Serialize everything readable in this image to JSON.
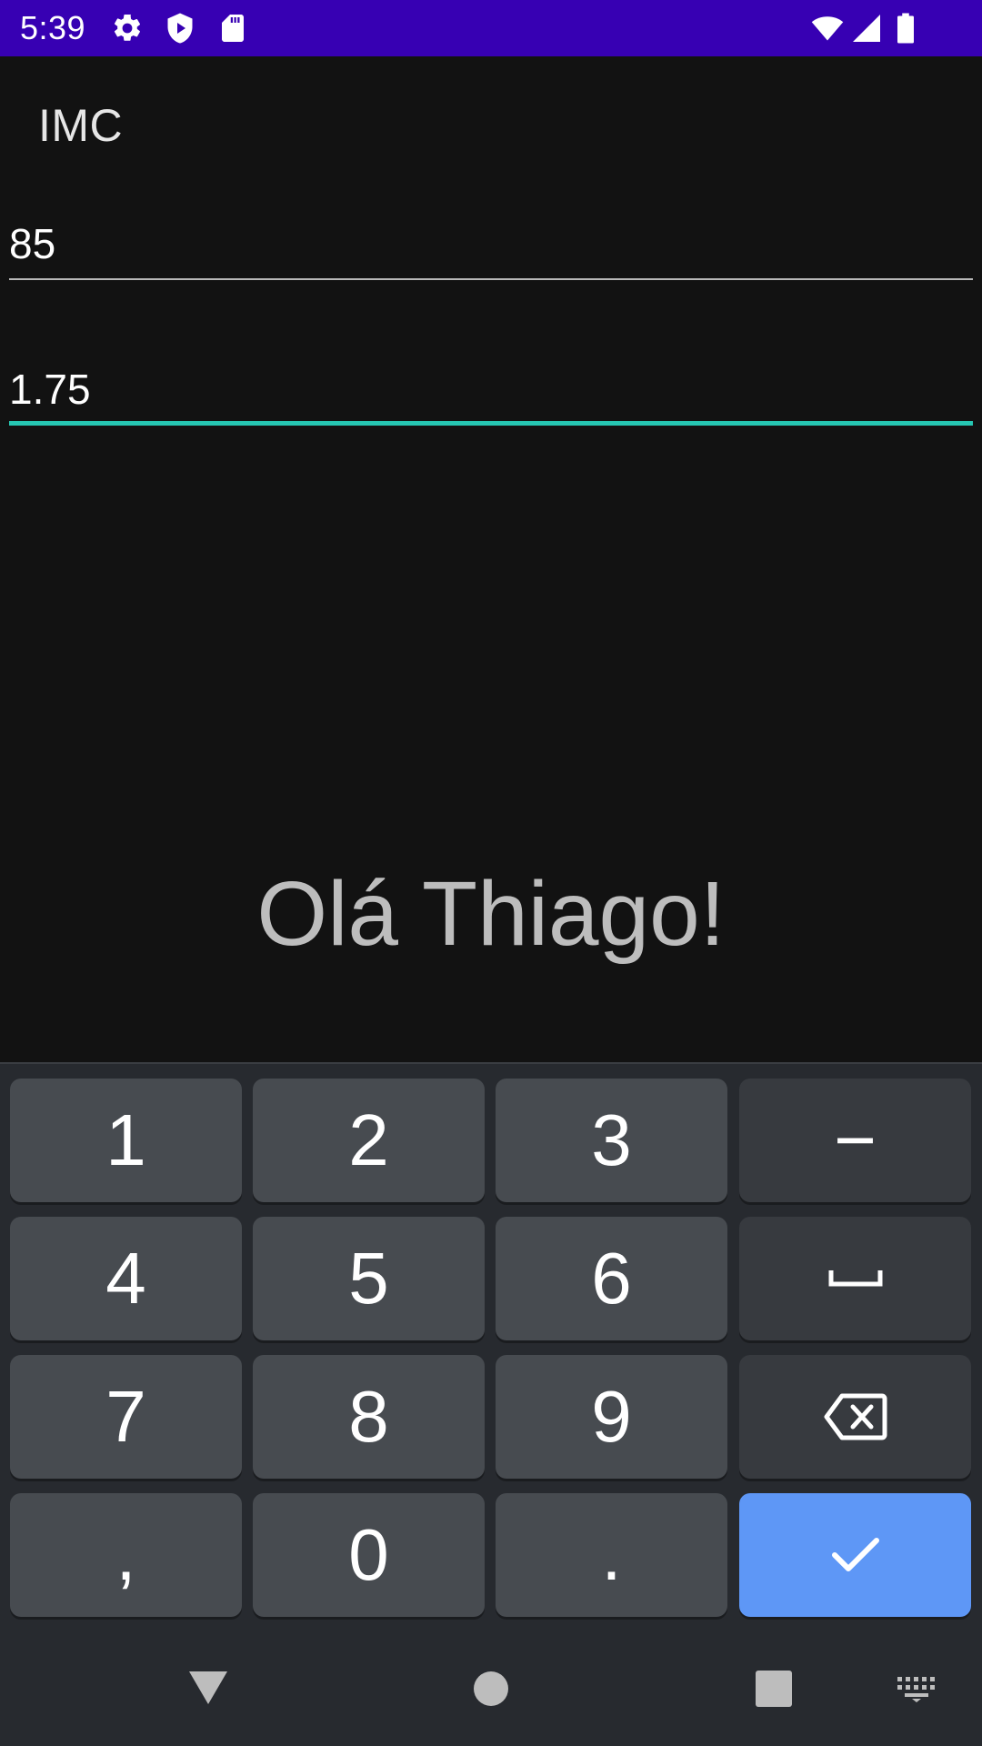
{
  "status_bar": {
    "time": "5:39",
    "background": "#3700b3",
    "icons_left": [
      "settings-icon",
      "play-protect-icon",
      "sd-card-icon"
    ],
    "icons_right": [
      "wifi-icon",
      "signal-icon",
      "battery-icon"
    ]
  },
  "app": {
    "title": "IMC",
    "fields": {
      "weight_value": "85",
      "height_value": "1.75"
    },
    "focused_field": "height",
    "accent": "#26c6b2",
    "greeting": "Olá Thiago!"
  },
  "keyboard": {
    "rows": [
      [
        {
          "label": "1"
        },
        {
          "label": "2"
        },
        {
          "label": "3"
        },
        {
          "label": "−",
          "kind": "fn"
        }
      ],
      [
        {
          "label": "4"
        },
        {
          "label": "5"
        },
        {
          "label": "6"
        },
        {
          "icon": "space-icon",
          "kind": "fn"
        }
      ],
      [
        {
          "label": "7"
        },
        {
          "label": "8"
        },
        {
          "label": "9"
        },
        {
          "icon": "backspace-icon",
          "kind": "fn"
        }
      ],
      [
        {
          "label": ","
        },
        {
          "label": "0"
        },
        {
          "label": "."
        },
        {
          "icon": "check-icon",
          "kind": "action"
        }
      ]
    ],
    "action_color": "#5e97f6"
  },
  "nav_bar": {
    "icons": [
      "back-icon",
      "home-icon",
      "recents-icon",
      "keyboard-switch-icon"
    ]
  }
}
